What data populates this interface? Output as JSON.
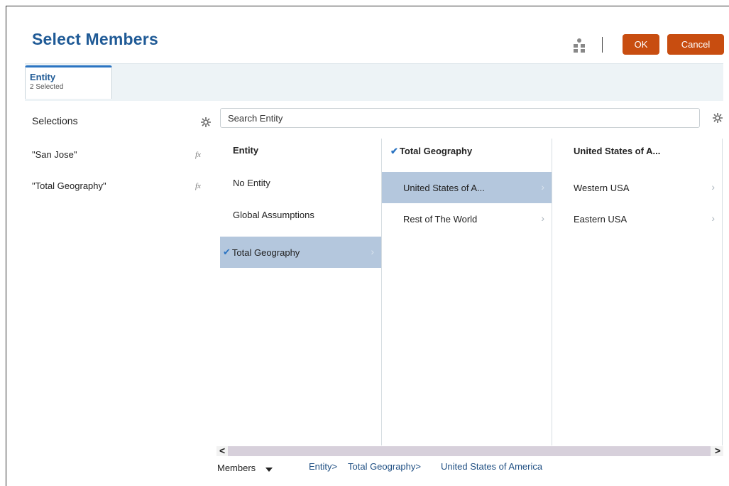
{
  "dialog": {
    "title": "Select Members"
  },
  "header": {
    "ok_label": "OK",
    "cancel_label": "Cancel"
  },
  "tab": {
    "title": "Entity",
    "subtitle": "2 Selected"
  },
  "selections": {
    "heading": "Selections",
    "items": [
      {
        "label": "\"San Jose\"",
        "fx": "fx"
      },
      {
        "label": "\"Total Geography\"",
        "fx": "fx"
      }
    ]
  },
  "search": {
    "value": "Search Entity"
  },
  "columns": [
    {
      "header": "Entity",
      "header_checked": false,
      "rows": [
        {
          "label": "No Entity",
          "checked": false,
          "highlighted": false,
          "has_children": false
        },
        {
          "label": "Global Assumptions",
          "checked": false,
          "highlighted": false,
          "has_children": false
        },
        {
          "label": "Total Geography",
          "checked": true,
          "highlighted": true,
          "has_children": true
        }
      ]
    },
    {
      "header": "Total Geography",
      "header_checked": true,
      "rows": [
        {
          "label": "United States of A...",
          "checked": false,
          "highlighted": true,
          "has_children": true
        },
        {
          "label": "Rest of The World",
          "checked": false,
          "highlighted": false,
          "has_children": true
        }
      ]
    },
    {
      "header": "United States of A...",
      "header_checked": false,
      "rows": [
        {
          "label": "Western USA",
          "checked": false,
          "highlighted": false,
          "has_children": true
        },
        {
          "label": "Eastern USA",
          "checked": false,
          "highlighted": false,
          "has_children": true
        }
      ]
    }
  ],
  "footer": {
    "members_label": "Members",
    "breadcrumb": [
      "Entity>",
      "Total Geography>",
      "United States of America"
    ]
  },
  "colors": {
    "accent": "#1f5a96",
    "button": "#c84d10",
    "highlight": "#b4c7dd",
    "check": "#2b74c2"
  },
  "icons": {
    "hierarchy": "hierarchy-icon",
    "settings": "gear-icon",
    "check": "checkmark-icon",
    "chevron": "chevron-right-icon"
  }
}
